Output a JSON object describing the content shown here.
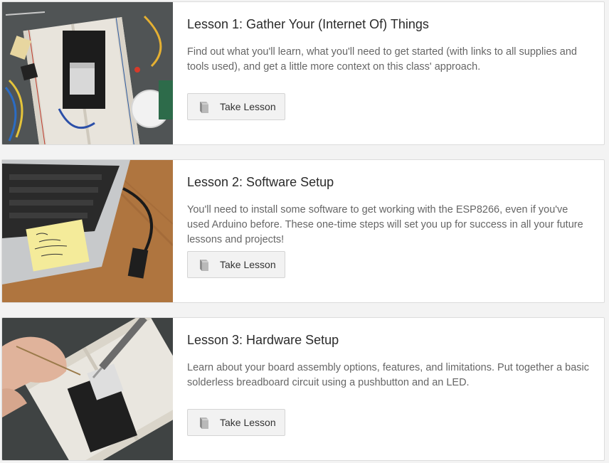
{
  "lessons": [
    {
      "title": "Lesson 1: Gather Your (Internet Of) Things",
      "description": "Find out what you'll learn, what you'll need to get started (with links to all supplies and tools used), and get a little more context on this class' approach.",
      "button_label": "Take Lesson",
      "image_icon": "breadboard-components-photo"
    },
    {
      "title": "Lesson 2: Software Setup",
      "description": "You'll need to install some software to get working with the ESP8266, even if you've used Arduino before. These one-time steps will set you up for success in all your future lessons and projects!",
      "button_label": "Take Lesson",
      "image_icon": "laptop-with-board-photo"
    },
    {
      "title": "Lesson 3: Hardware Setup",
      "description": "Learn about your board assembly options, features, and limitations. Put together a basic solderless breadboard circuit using a pushbutton and an LED.",
      "button_label": "Take Lesson",
      "image_icon": "soldering-breadboard-photo"
    }
  ],
  "button_icon": "book-icon",
  "colors": {
    "page_background": "#f3f3f3",
    "card_background": "#ffffff",
    "title_text": "#2a2a2a",
    "description_text": "#666666",
    "button_background": "#f2f2f2"
  }
}
